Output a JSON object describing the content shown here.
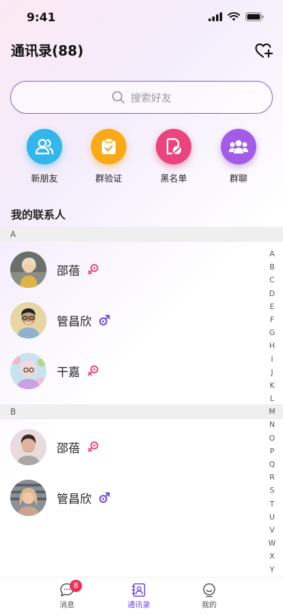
{
  "status": {
    "time": "9:41"
  },
  "header": {
    "title": "通讯录(88)"
  },
  "search": {
    "placeholder": "搜索好友"
  },
  "quick_actions": [
    {
      "label": "新朋友",
      "color": "#33b6ea",
      "icon": "users-icon"
    },
    {
      "label": "群验证",
      "color": "#f9a91a",
      "icon": "clipboard-check-icon"
    },
    {
      "label": "黑名单",
      "color": "#e8457c",
      "icon": "block-doc-icon"
    },
    {
      "label": "群聊",
      "color": "#a25ce6",
      "icon": "group-icon"
    }
  ],
  "section": {
    "title": "我的联系人"
  },
  "groups": [
    {
      "letter": "A",
      "contacts": [
        {
          "name": "邵蓓",
          "gender": "female"
        },
        {
          "name": "管昌欣",
          "gender": "male"
        },
        {
          "name": "干嘉",
          "gender": "female"
        }
      ]
    },
    {
      "letter": "B",
      "contacts": [
        {
          "name": "邵蓓",
          "gender": "female"
        },
        {
          "name": "管昌欣",
          "gender": "male"
        }
      ]
    }
  ],
  "index_letters": [
    "A",
    "B",
    "C",
    "D",
    "E",
    "F",
    "G",
    "H",
    "I",
    "J",
    "K",
    "L",
    "M",
    "N",
    "O",
    "P",
    "Q",
    "R",
    "S",
    "T",
    "U",
    "V",
    "W",
    "X",
    "Y"
  ],
  "tabs": [
    {
      "label": "消息",
      "badge": "8"
    },
    {
      "label": "通讯录"
    },
    {
      "label": "我的"
    }
  ],
  "colors": {
    "accent": "#6d46d9",
    "female": "#e8457c",
    "male": "#6d46d9",
    "badge": "#e5335a"
  }
}
